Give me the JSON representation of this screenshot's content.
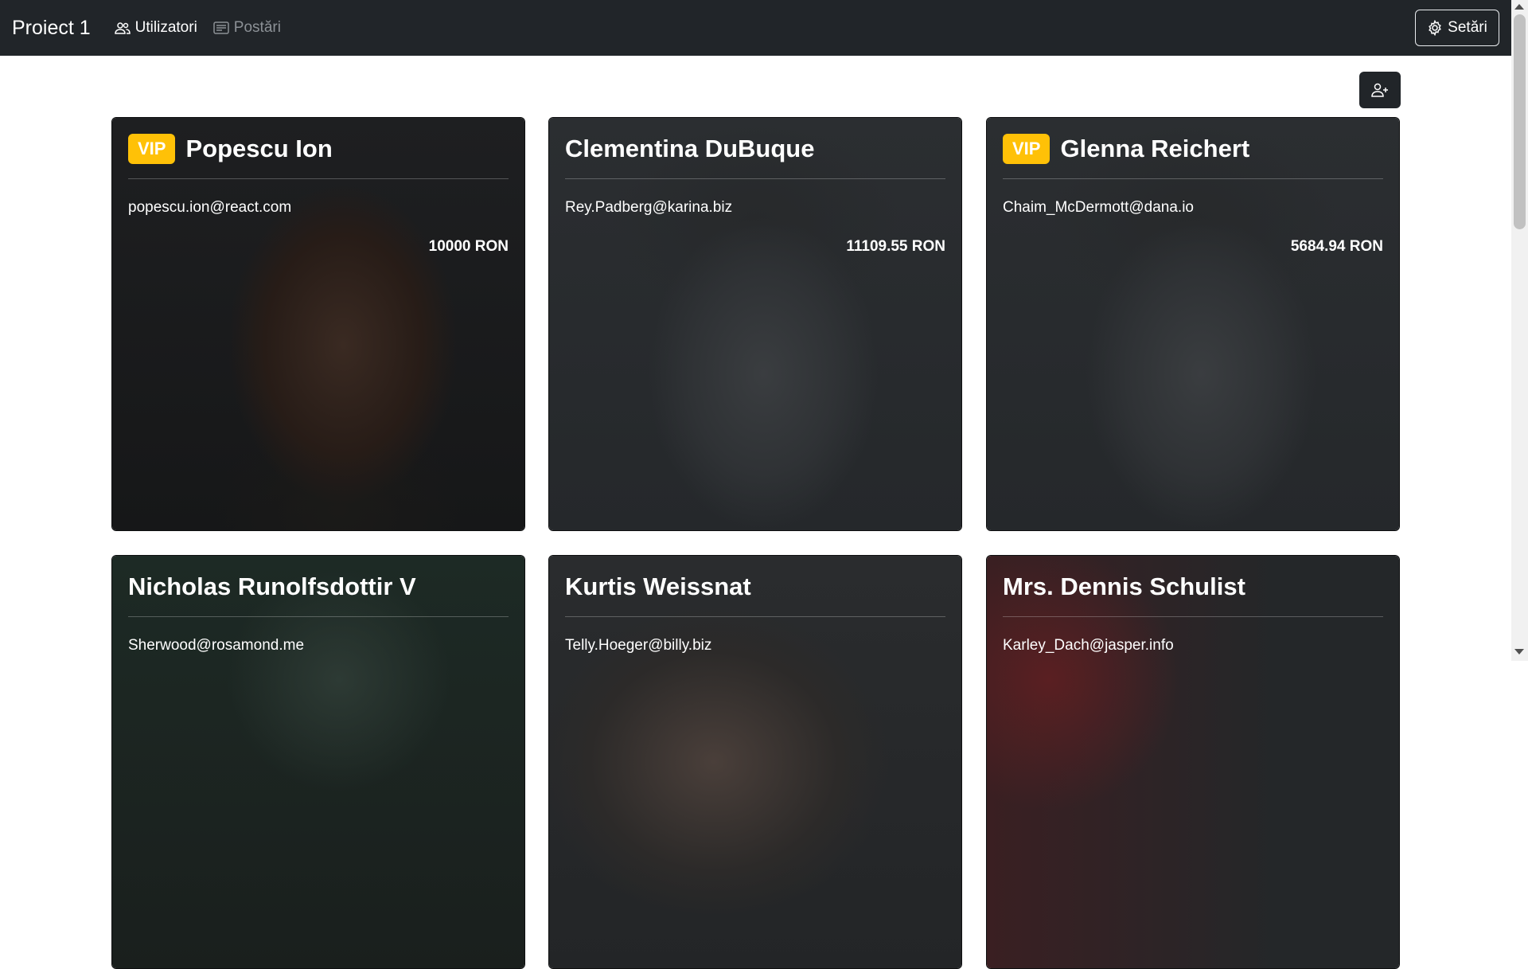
{
  "navbar": {
    "brand": "Proiect 1",
    "links": [
      {
        "label": "Utilizatori",
        "active": true
      },
      {
        "label": "Postări",
        "active": false
      }
    ],
    "settings_label": "Setări"
  },
  "actions": {
    "add_user_icon": "person-plus-icon"
  },
  "cards": [
    {
      "vip": "VIP",
      "name": "Popescu Ion",
      "email": "popescu.ion@react.com",
      "amount": "10000 RON"
    },
    {
      "vip": "",
      "name": "Clementina DuBuque",
      "email": "Rey.Padberg@karina.biz",
      "amount": "11109.55 RON"
    },
    {
      "vip": "VIP",
      "name": "Glenna Reichert",
      "email": "Chaim_McDermott@dana.io",
      "amount": "5684.94 RON"
    },
    {
      "vip": "",
      "name": "Nicholas Runolfsdottir V",
      "email": "Sherwood@rosamond.me",
      "amount": ""
    },
    {
      "vip": "",
      "name": "Kurtis Weissnat",
      "email": "Telly.Hoeger@billy.biz",
      "amount": ""
    },
    {
      "vip": "",
      "name": "Mrs. Dennis Schulist",
      "email": "Karley_Dach@jasper.info",
      "amount": ""
    }
  ],
  "colors": {
    "navbar_bg": "#212529",
    "vip_badge": "#ffc107"
  }
}
